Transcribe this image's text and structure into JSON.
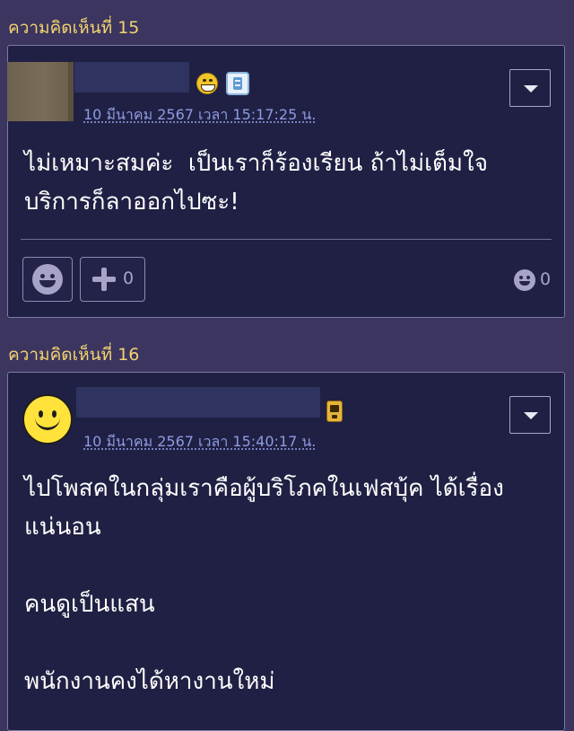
{
  "comments": [
    {
      "header": "ความคิดเห็นที่ 15",
      "date": "10 มีนาคม 2567 เวลา 15:17:25 น.",
      "body": "ไม่เหมาะสมค่ะ  เป็นเราก็ร้องเรียน ถ้าไม่เต็มใจ\nบริการก็ลาออกไปซะ!",
      "plus_count": "0",
      "emotion_count": "0",
      "avatar_icon": "photo-avatar",
      "badges": [
        "grin-emoji-icon",
        "blog-b-icon"
      ]
    },
    {
      "header": "ความคิดเห็นที่ 16",
      "date": "10 มีนาคม 2567 เวลา 15:40:17 น.",
      "body": "ไปโพสคในกลุ่มเราคือผู้บริโภคในเฟสบุ้ค ได้เรื่อง\nแน่นอน\n\nคนดูเป็นแสน\n\nพนักงานคงได้หางานใหม่",
      "avatar_icon": "yellow-smiley-avatar",
      "badges": [
        "phone-icon"
      ]
    }
  ],
  "colors": {
    "page_bg": "#3b3560",
    "card_bg": "#202044",
    "header_text": "#f3d36e",
    "date_link": "#8e9be0"
  }
}
